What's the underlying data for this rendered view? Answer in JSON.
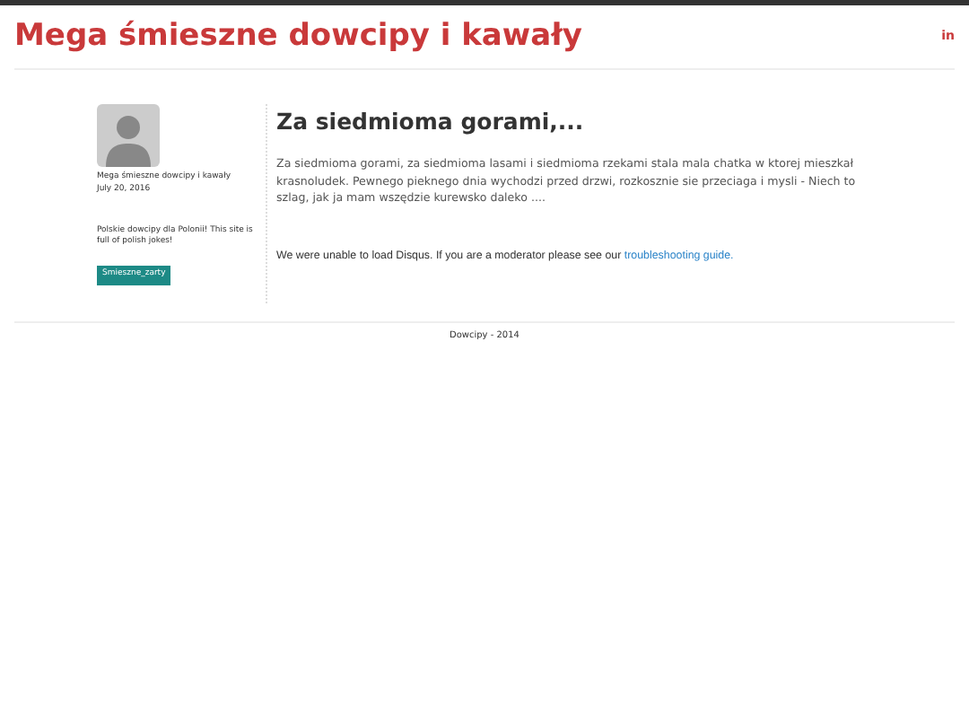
{
  "site": {
    "title": "Mega śmieszne dowcipy i kawały",
    "social_link": "in"
  },
  "author": {
    "name": "Mega śmieszne dowcipy i kawały",
    "date": "July 20, 2016",
    "bio": "Polskie dowcipy dla Polonii! This site is full of polish jokes!",
    "tags": [
      "Smieszne_zarty"
    ]
  },
  "post": {
    "title": "Za siedmioma gorami,...",
    "body": "Za siedmioma gorami, za siedmioma lasami i siedmioma rzekami stala mala chatka w ktorej mieszkał krasnoludek. Pewnego pieknego dnia wychodzi przed drzwi, rozkosznie sie przeciaga i mysli - Niech to szlag, jak ja mam wszędzie kurewsko daleko ....",
    "comments_notice": "We were unable to load Disqus. If you are a moderator please see our",
    "comments_link": "troubleshooting guide."
  },
  "footer": {
    "text": "Dowcipy - 2014"
  }
}
